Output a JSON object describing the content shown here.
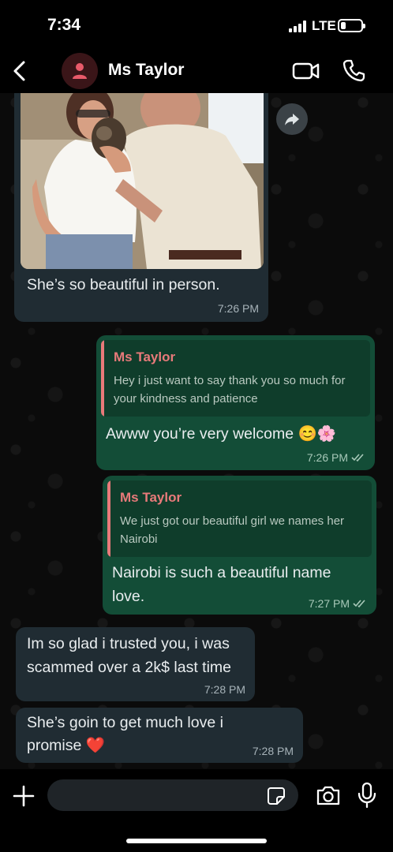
{
  "status_bar": {
    "time": "7:34",
    "network": "LTE",
    "battery_level": 0.25
  },
  "header": {
    "contact_name": "Ms Taylor",
    "icons": [
      "back-icon",
      "avatar-person-icon",
      "video-call-icon",
      "phone-call-icon"
    ]
  },
  "messages": [
    {
      "direction": "incoming",
      "has_photo": true,
      "text": "She’s so beautiful in person.",
      "time": "7:26 PM"
    },
    {
      "direction": "outgoing",
      "quote_name": "Ms Taylor",
      "quote_text": "Hey i just want to say thank you so much for your kindness and patience",
      "text": "Awww you’re very welcome 😊🌸",
      "time": "7:26 PM",
      "status": "read"
    },
    {
      "direction": "outgoing",
      "quote_name": "Ms Taylor",
      "quote_text": "We just got our beautiful girl we names her Nairobi",
      "text": "Nairobi is such a beautiful name love.",
      "time": "7:27 PM",
      "status": "read"
    },
    {
      "direction": "incoming",
      "text": "Im so glad i trusted you, i was scammed over a 2k$ last time",
      "time": "7:28 PM"
    },
    {
      "direction": "incoming",
      "text": "She’s goin to get much love i promise ❤️",
      "time": "7:28 PM"
    }
  ],
  "input_bar": {
    "placeholder": "",
    "value": ""
  },
  "colors": {
    "incoming_bubble": "#202c33",
    "outgoing_bubble": "#134d37",
    "quote_accent": "#e87a7a"
  }
}
